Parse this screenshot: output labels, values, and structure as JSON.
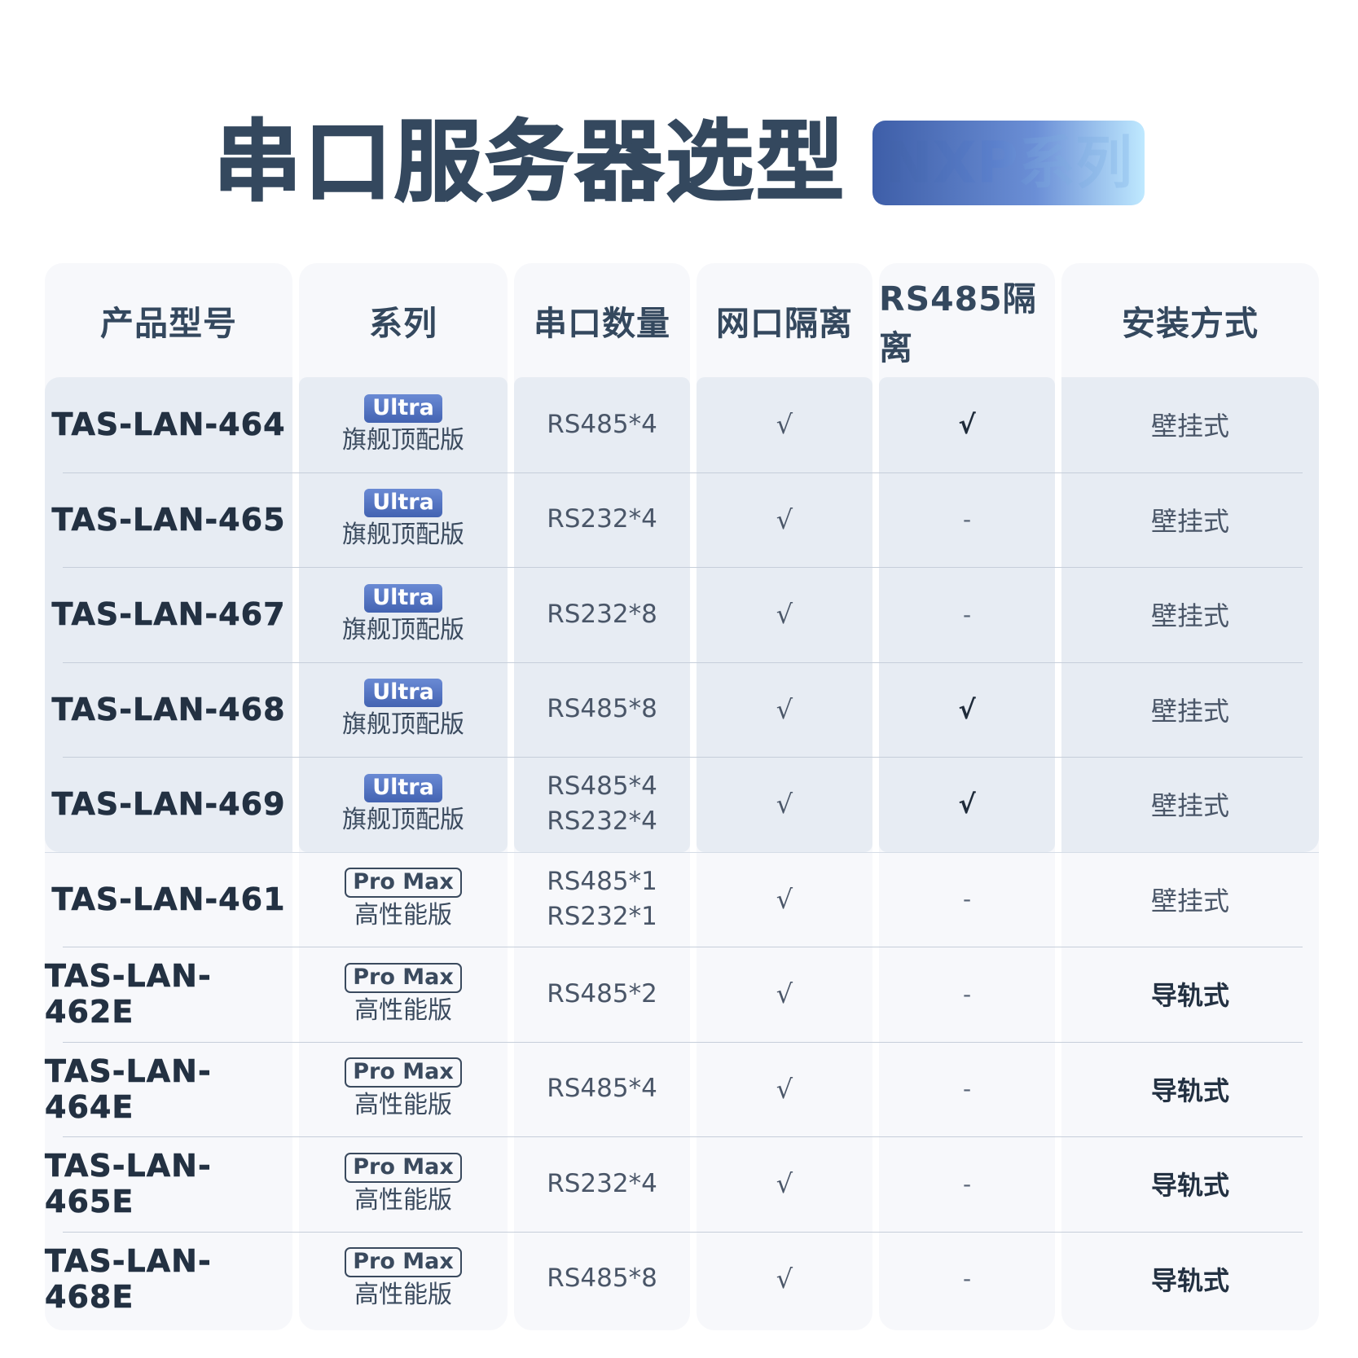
{
  "title": {
    "main": "串口服务器选型",
    "badge": "NXP系列"
  },
  "headers": [
    "产品型号",
    "系列",
    "串口数量",
    "网口隔离",
    "RS485隔离",
    "安装方式"
  ],
  "rows": [
    {
      "model": "TAS-LAN-464",
      "series_badge": "Ultra",
      "series_edition": "旗舰顶配版",
      "ports": [
        "RS485*4"
      ],
      "net_isolation": "√",
      "rs485_isolation": "√",
      "mount": "壁挂式"
    },
    {
      "model": "TAS-LAN-465",
      "series_badge": "Ultra",
      "series_edition": "旗舰顶配版",
      "ports": [
        "RS232*4"
      ],
      "net_isolation": "√",
      "rs485_isolation": "-",
      "mount": "壁挂式"
    },
    {
      "model": "TAS-LAN-467",
      "series_badge": "Ultra",
      "series_edition": "旗舰顶配版",
      "ports": [
        "RS232*8"
      ],
      "net_isolation": "√",
      "rs485_isolation": "-",
      "mount": "壁挂式"
    },
    {
      "model": "TAS-LAN-468",
      "series_badge": "Ultra",
      "series_edition": "旗舰顶配版",
      "ports": [
        "RS485*8"
      ],
      "net_isolation": "√",
      "rs485_isolation": "√",
      "mount": "壁挂式"
    },
    {
      "model": "TAS-LAN-469",
      "series_badge": "Ultra",
      "series_edition": "旗舰顶配版",
      "ports": [
        "RS485*4",
        "RS232*4"
      ],
      "net_isolation": "√",
      "rs485_isolation": "√",
      "mount": "壁挂式"
    },
    {
      "model": "TAS-LAN-461",
      "series_badge": "Pro Max",
      "series_edition": "高性能版",
      "ports": [
        "RS485*1",
        "RS232*1"
      ],
      "net_isolation": "√",
      "rs485_isolation": "-",
      "mount": "壁挂式"
    },
    {
      "model": "TAS-LAN-462E",
      "series_badge": "Pro Max",
      "series_edition": "高性能版",
      "ports": [
        "RS485*2"
      ],
      "net_isolation": "√",
      "rs485_isolation": "-",
      "mount": "导轨式"
    },
    {
      "model": "TAS-LAN-464E",
      "series_badge": "Pro Max",
      "series_edition": "高性能版",
      "ports": [
        "RS485*4"
      ],
      "net_isolation": "√",
      "rs485_isolation": "-",
      "mount": "导轨式"
    },
    {
      "model": "TAS-LAN-465E",
      "series_badge": "Pro Max",
      "series_edition": "高性能版",
      "ports": [
        "RS232*4"
      ],
      "net_isolation": "√",
      "rs485_isolation": "-",
      "mount": "导轨式"
    },
    {
      "model": "TAS-LAN-468E",
      "series_badge": "Pro Max",
      "series_edition": "高性能版",
      "ports": [
        "RS485*8"
      ],
      "net_isolation": "√",
      "rs485_isolation": "-",
      "mount": "导轨式"
    }
  ],
  "colors": {
    "title": "#34485e",
    "ultra_badge": "#4a6bb8",
    "highlight_rows_bg": "#e7ecf3",
    "column_bg": "#f7f8fb"
  }
}
